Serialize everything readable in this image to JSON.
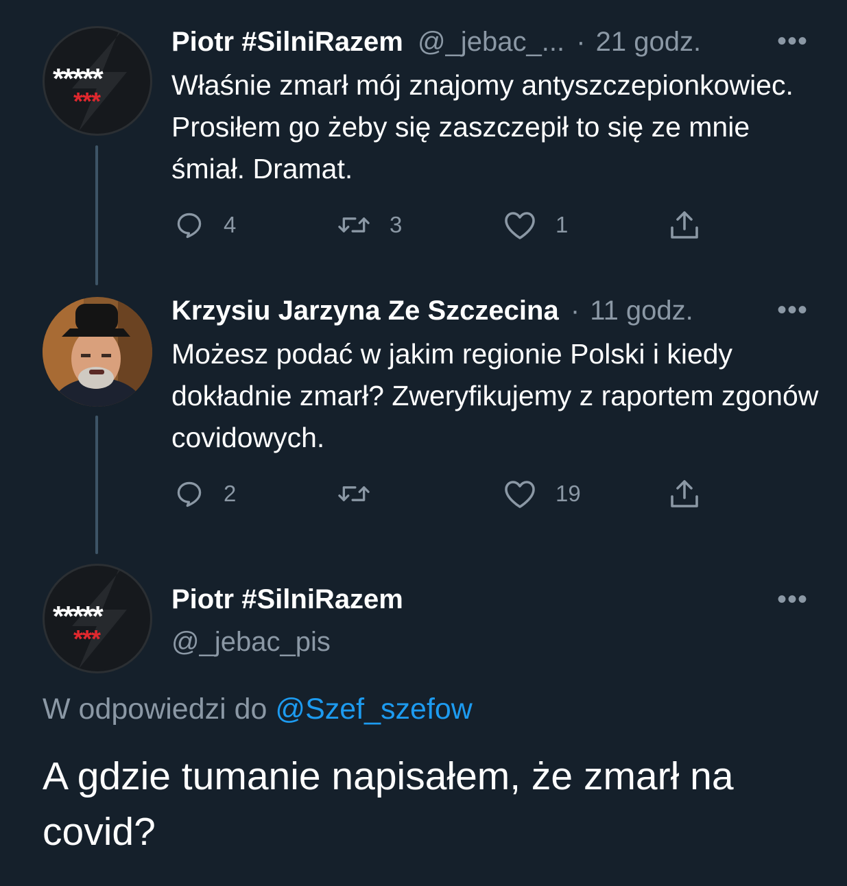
{
  "tweets": [
    {
      "name": "Piotr #SilniRazem",
      "handle": "@_jebac_...",
      "separator": "·",
      "time": "21 godz.",
      "text": "Właśnie zmarł mój znajomy antyszczepionkowiec. Prosiłem go żeby się zaszczepił to się ze mnie śmiał. Dramat.",
      "avatar": {
        "stars_white": "*****",
        "stars_red": "***"
      },
      "actions": {
        "replies": "4",
        "retweets": "3",
        "likes": "1"
      }
    },
    {
      "name": "Krzysiu Jarzyna Ze Szczecina",
      "separator": "·",
      "time": "11 godz.",
      "text": "Możesz podać w jakim regionie Polski i kiedy dokładnie zmarł? Zweryfikujemy z raportem zgonów covidowych.",
      "actions": {
        "replies": "2",
        "retweets": "",
        "likes": "19"
      }
    }
  ],
  "main_tweet": {
    "name": "Piotr #SilniRazem",
    "handle": "@_jebac_pis",
    "avatar": {
      "stars_white": "*****",
      "stars_red": "***"
    },
    "reply_prefix": "W odpowiedzi do",
    "reply_to": "@Szef_szefow",
    "text": "A gdzie tumanie napisałem, że zmarł na covid?"
  },
  "more_glyph": "•••",
  "colors": {
    "background": "#15202b",
    "secondary": "#8b98a5",
    "accent": "#1d9bf0",
    "thread_line": "#3d5466"
  },
  "icons": [
    "reply-icon",
    "retweet-icon",
    "like-icon",
    "share-icon",
    "more-icon"
  ]
}
